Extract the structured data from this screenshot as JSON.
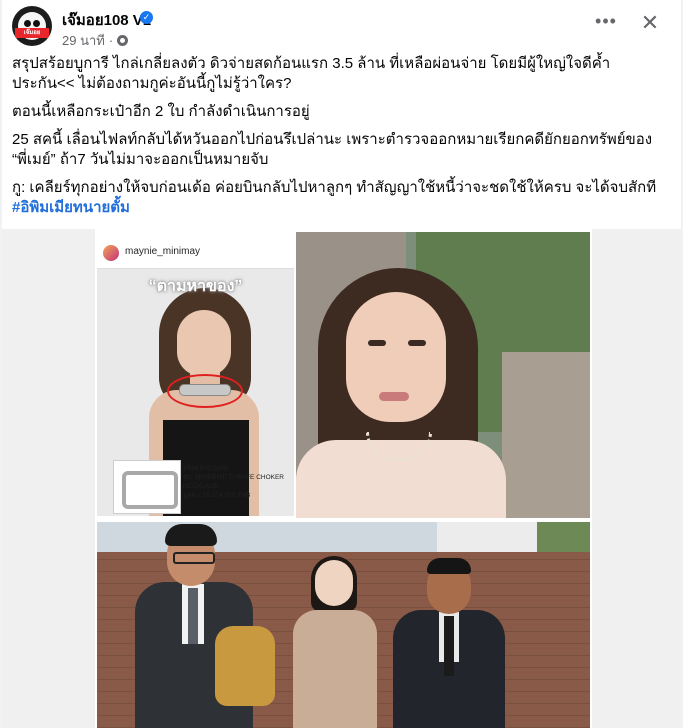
{
  "post": {
    "page_name": "เจ๊มอย108 V1",
    "time": "29 นาที",
    "avatar_badge": "เจ๊มอย",
    "paragraphs": [
      "สรุปสร้อยบูการี ไกล่เกลี่ยลงตัว ดิวจ่ายสดก้อนแรก 3.5 ล้าน ที่เหลือผ่อนจ่าย โดยมีผู้ใหญ่ใจดีค้ำประกัน<< ไม่ต้องถามกูค่ะอันนี้กูไม่รู้ว่าใคร?",
      "ตอนนี้เหลือกระเป๋าอีก 2 ใบ กำลังดำเนินการอยู่",
      "25 สคนี้ เลื่อนไฟลท์กลับได้หวันออกไปก่อนรึเปล่านะ เพราะตำรวจออกหมายเรียกคดียักยอกทรัพย์ของ “พี่เมย์” ถ้า7 วันไม่มาจะออกเป็นหมายจับ",
      "กู: เคลียร์ทุกอย่างให้จบก่อนเด้อ ค่อยบินกลับไปหาลูกๆ ทำสัญญาใช้หนี้ว่าจะชดใช้ให้ครบ จะได้จบสักที"
    ],
    "hashtag": "#อิพิมเมียทนายตั้ม"
  },
  "collage": {
    "ig_username": "maynie_minimay",
    "ig_caption": "“ตามหาของ”",
    "product_lines": [
      "สร้อย BVLGARI",
      "รุ่น: SERPENTI TUBAFE CHOKER",
      "NECKLACE",
      "มูลค่า: 15,274,000 THB"
    ]
  }
}
